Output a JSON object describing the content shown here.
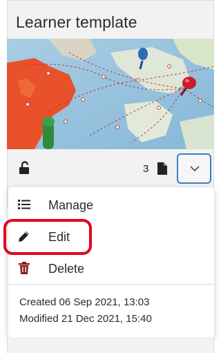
{
  "card": {
    "title": "Learner template",
    "page_count": "3",
    "lock_icon": "unlock-icon",
    "file_icon": "file-icon",
    "menu_toggle_icon": "chevron-down-icon",
    "accent_color": "#3b7dc4"
  },
  "menu": {
    "items": [
      {
        "label": "Manage",
        "icon": "list-icon"
      },
      {
        "label": "Edit",
        "icon": "pencil-icon"
      },
      {
        "label": "Delete",
        "icon": "trash-icon"
      }
    ],
    "created": "Created 06 Sep 2021, 13:03",
    "modified": "Modified 21 Dec 2021, 15:40",
    "highlight_color": "#e3001b"
  }
}
